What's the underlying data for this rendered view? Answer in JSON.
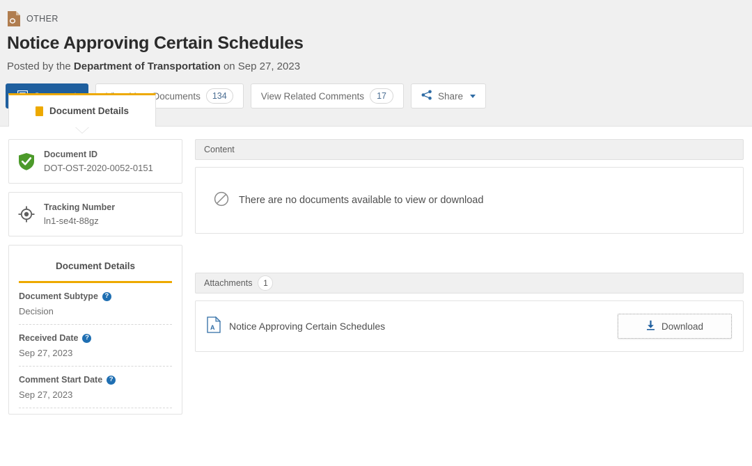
{
  "header": {
    "doc_type_label": "OTHER",
    "doc_type_icon": "document-other-icon",
    "title": "Notice Approving Certain Schedules",
    "posted_prefix": "Posted by the",
    "agency": "Department of Transportation",
    "posted_suffix": "on Sep 27, 2023",
    "buttons": {
      "comment": {
        "label": "Comment",
        "icon": "comment-icon"
      },
      "view_more_documents": {
        "label": "View More Documents",
        "count": "134"
      },
      "view_related_comments": {
        "label": "View Related Comments",
        "count": "17"
      },
      "share": {
        "label": "Share",
        "icon": "share-icon"
      }
    }
  },
  "tabs": [
    {
      "label": "Document Details",
      "icon": "document-tab-icon",
      "active": true
    }
  ],
  "sidebar": {
    "document_id": {
      "label": "Document ID",
      "value": "DOT-OST-2020-0052-0151",
      "icon": "shield-check-icon"
    },
    "tracking_number": {
      "label": "Tracking Number",
      "value": "ln1-se4t-88gz",
      "icon": "target-icon"
    },
    "details_panel": {
      "title": "Document Details",
      "rows": [
        {
          "label": "Document Subtype",
          "value": "Decision",
          "help": "?"
        },
        {
          "label": "Received Date",
          "value": "Sep 27, 2023",
          "help": "?"
        },
        {
          "label": "Comment Start Date",
          "value": "Sep 27, 2023",
          "help": "?"
        }
      ]
    }
  },
  "main": {
    "content_section": {
      "header": "Content",
      "empty_message": "There are no documents available to view or download",
      "empty_icon": "no-entry-icon"
    },
    "attachments_section": {
      "header": "Attachments",
      "count": "1",
      "items": [
        {
          "name": "Notice Approving Certain Schedules",
          "icon": "pdf-file-icon",
          "download_label": "Download",
          "download_icon": "download-arrow-icon"
        }
      ]
    }
  },
  "colors": {
    "accent_orange": "#eda900",
    "primary_blue": "#1f5f9e",
    "link_blue": "#2f6ca5",
    "green": "#4c9a2a",
    "header_bg": "#f0f0f0"
  }
}
